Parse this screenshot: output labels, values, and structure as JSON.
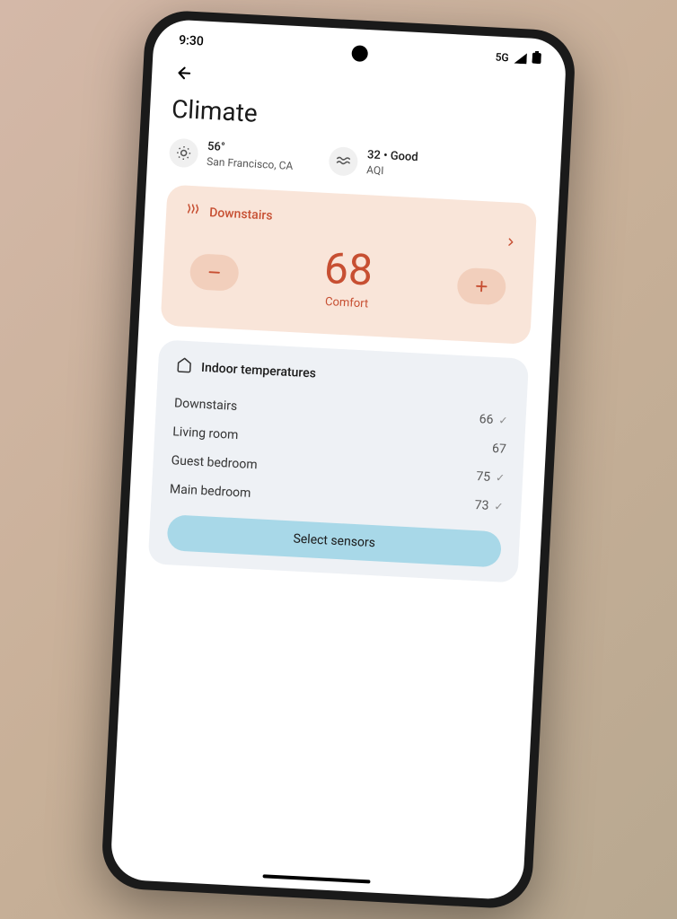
{
  "status_bar": {
    "time": "9:30",
    "network": "5G"
  },
  "page": {
    "title": "Climate"
  },
  "weather": {
    "temp": "56°",
    "location": "San Francisco, CA",
    "aqi_value": "32 • Good",
    "aqi_label": "AQI"
  },
  "thermostat": {
    "zone": "Downstairs",
    "temperature": "68",
    "mode": "Comfort"
  },
  "sensors": {
    "header": "Indoor temperatures",
    "rows": [
      {
        "name": "Downstairs",
        "value": "66",
        "checked": true
      },
      {
        "name": "Living room",
        "value": "67",
        "checked": false
      },
      {
        "name": "Guest bedroom",
        "value": "75",
        "checked": true
      },
      {
        "name": "Main bedroom",
        "value": "73",
        "checked": true
      }
    ],
    "button": "Select sensors"
  }
}
